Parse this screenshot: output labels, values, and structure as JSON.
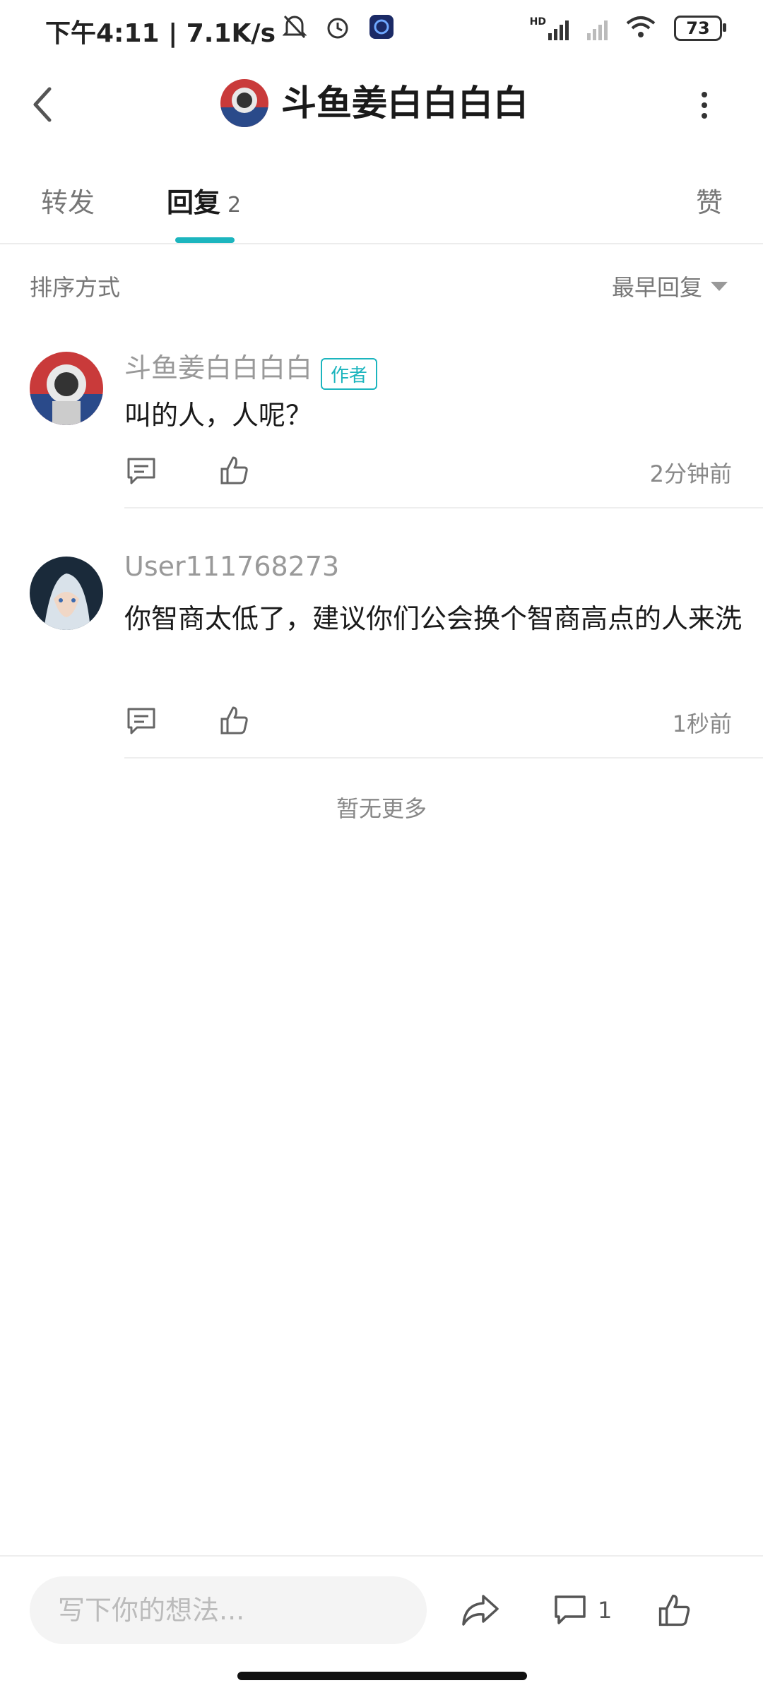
{
  "status_bar": {
    "time": "下午4:11 | 7.1K/s",
    "battery": "73",
    "network_label": "HD"
  },
  "header": {
    "title": "斗鱼姜白白白白"
  },
  "tabs": [
    {
      "label": "转发"
    },
    {
      "label": "回复",
      "count": "2"
    },
    {
      "label": "赞"
    }
  ],
  "sort": {
    "label": "排序方式",
    "value": "最早回复"
  },
  "comments": [
    {
      "username": "斗鱼姜白白白白",
      "badge": "作者",
      "text": "叫的人，人呢？",
      "time": "2分钟前"
    },
    {
      "username": "User111768273",
      "text": "你智商太低了，建议你们公会换个智商高点的人来洗",
      "time": "1秒前"
    }
  ],
  "no_more": "暂无更多",
  "bottom_bar": {
    "placeholder": "写下你的想法...",
    "comment_count": "1"
  },
  "colors": {
    "accent": "#1cb5be",
    "muted_text": "#999999"
  },
  "icons": [
    "back-arrow-icon",
    "more-dots-icon",
    "caret-down-icon",
    "comment-icon",
    "like-icon",
    "share-icon",
    "bell-mute-icon",
    "alarm-icon",
    "wifi-icon",
    "signal-icon"
  ]
}
